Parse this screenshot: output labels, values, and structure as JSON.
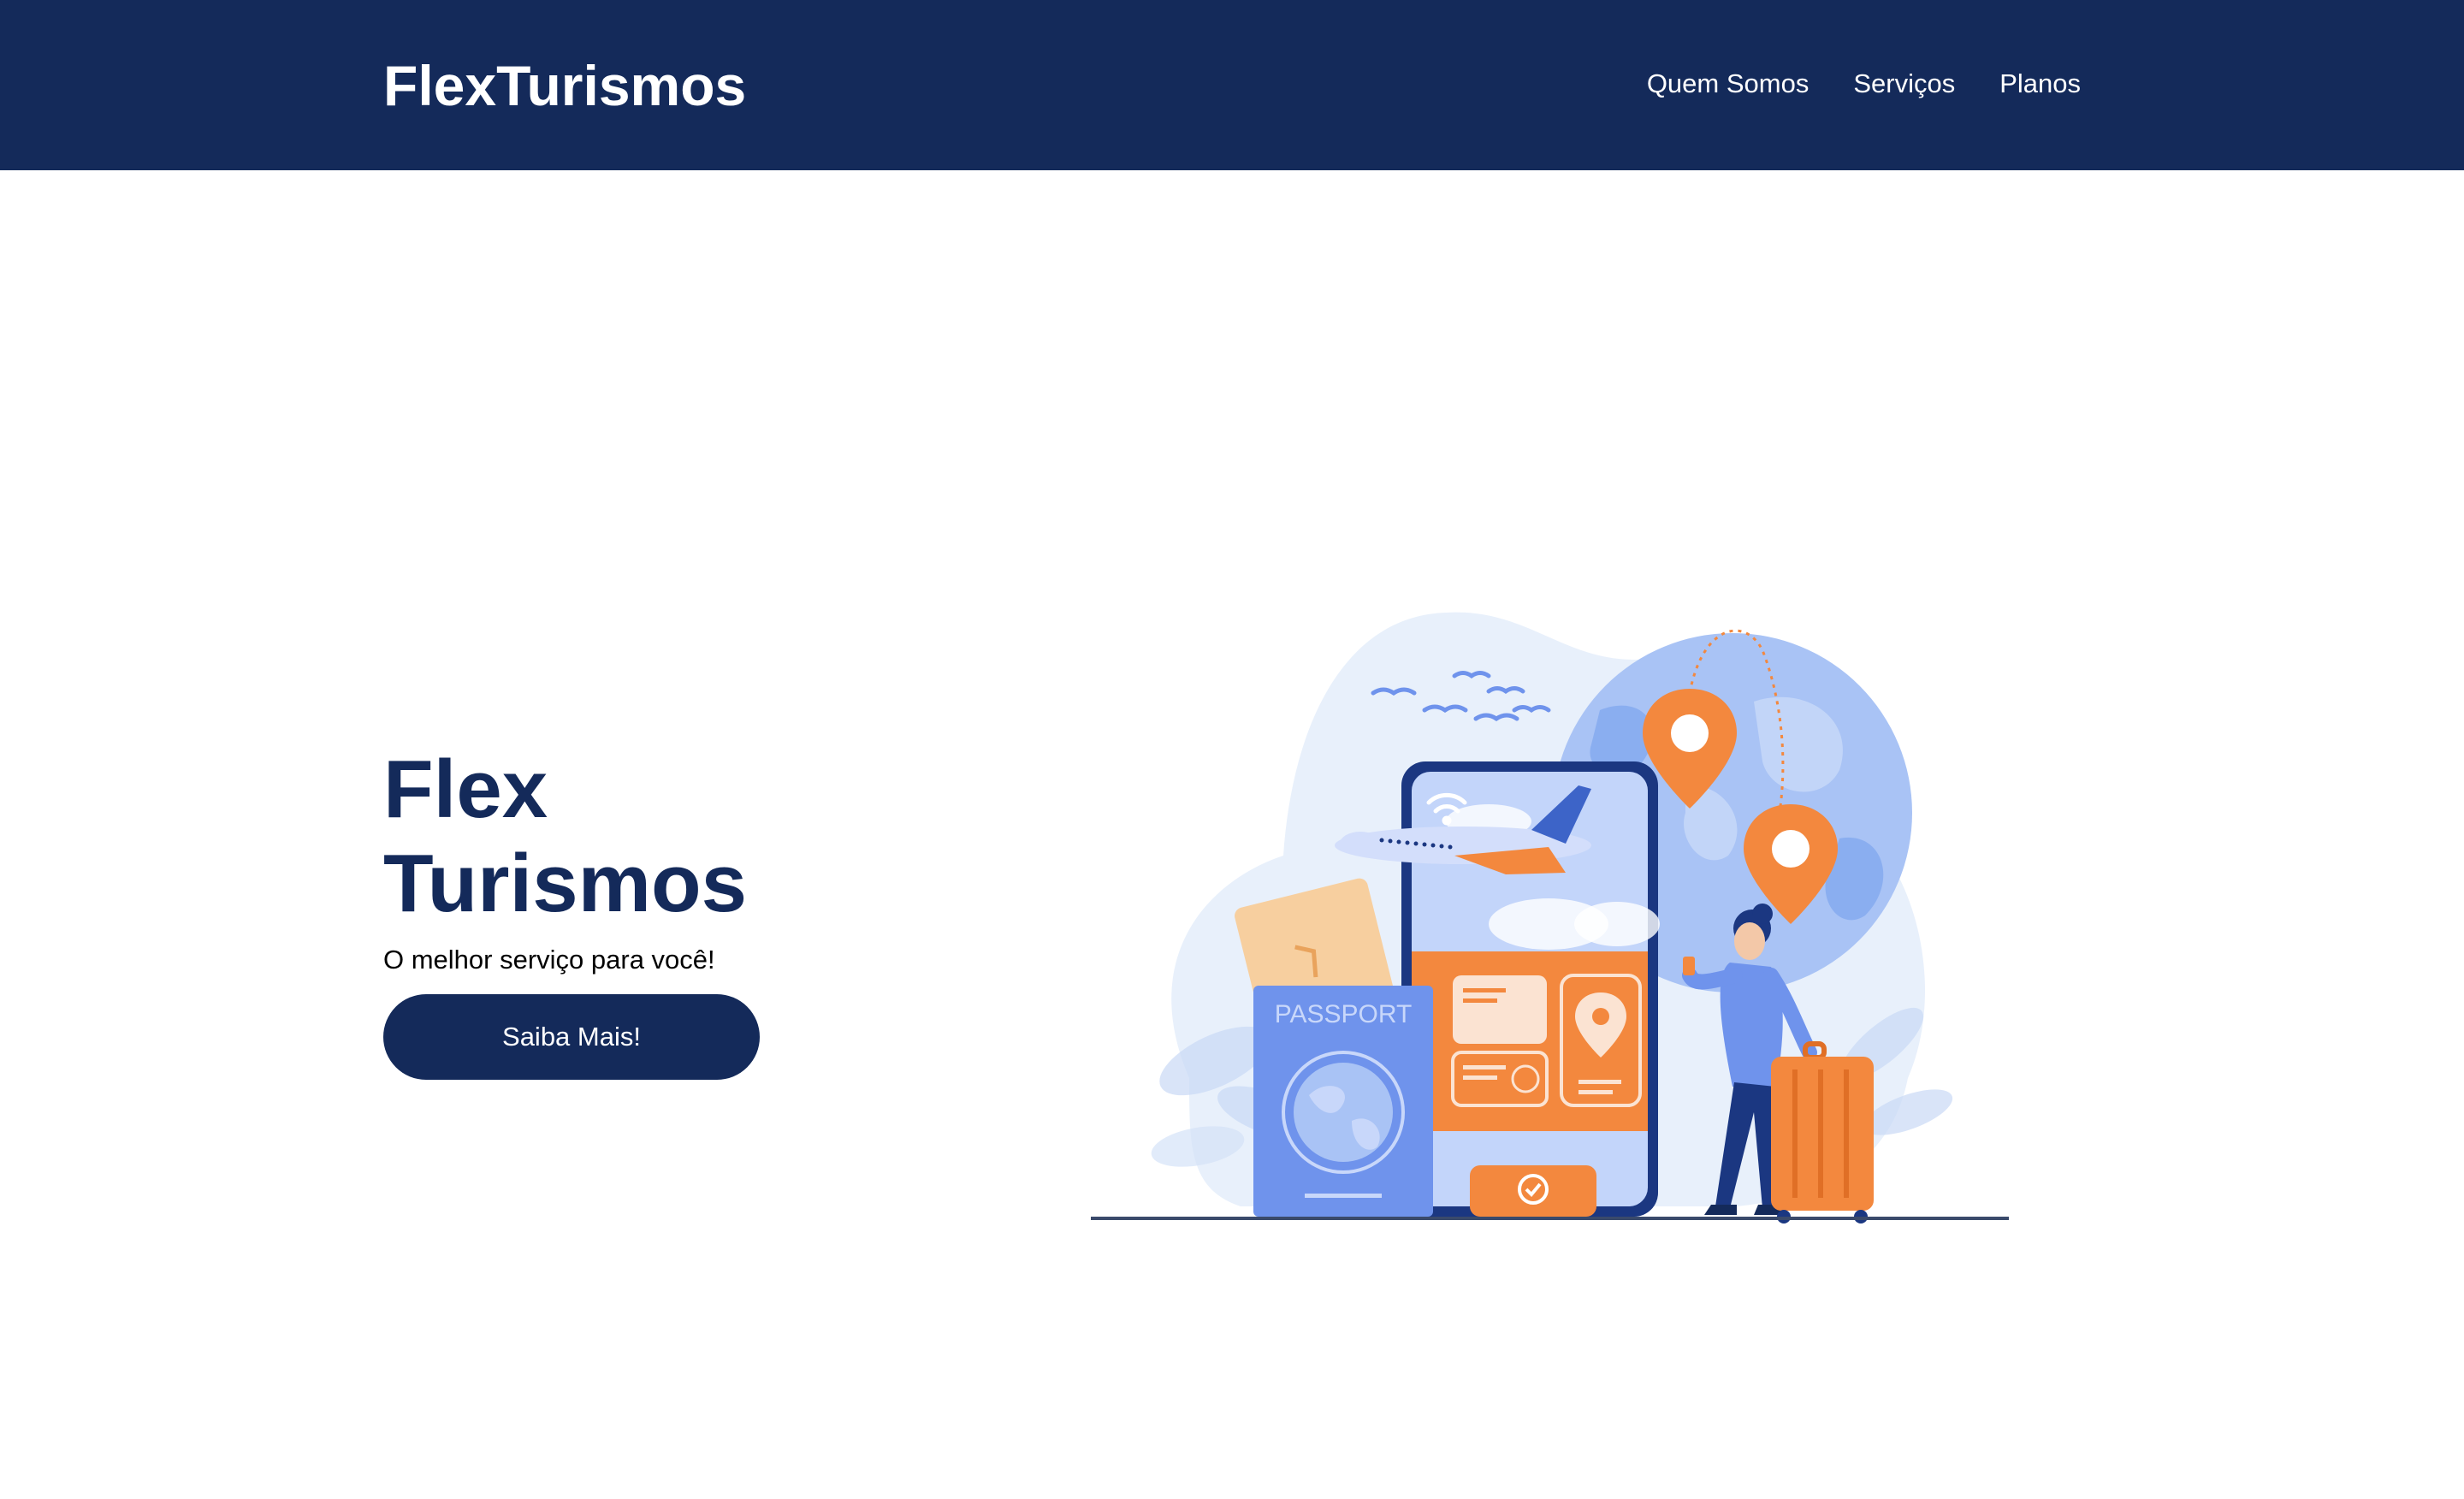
{
  "navbar": {
    "logo": "FlexTurismos",
    "links": [
      "Quem Somos",
      "Serviços",
      "Planos"
    ]
  },
  "hero": {
    "title_line1": "Flex",
    "title_line2": "Turismos",
    "subtitle": "O melhor serviço para você!",
    "button_label": "Saiba Mais!",
    "illustration": {
      "passport_text": "PASSPORT",
      "icons": [
        "airplane-icon",
        "location-pin-icon",
        "wifi-icon",
        "passport-icon",
        "suitcase-icon",
        "globe-icon",
        "birds-icon"
      ]
    }
  },
  "colors": {
    "navy": "#142a5a",
    "orange": "#f3883e",
    "blue": "#6f93ec",
    "light_blue": "#e8f0fb",
    "white": "#ffffff"
  }
}
